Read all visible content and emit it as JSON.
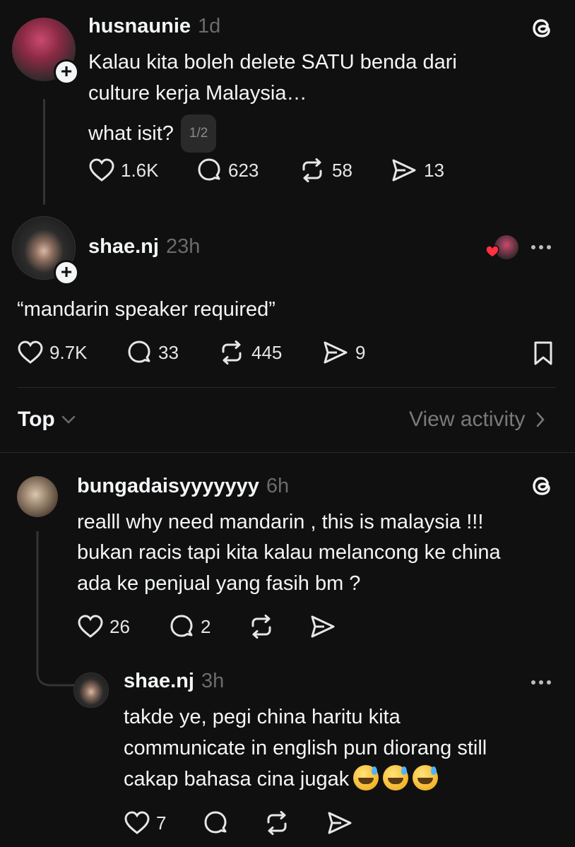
{
  "post1": {
    "username": "husnaunie",
    "time": "1d",
    "lines": [
      "Kalau kita boleh delete SATU benda dari",
      "culture kerja Malaysia…"
    ],
    "line3": "what isit?",
    "page_indicator": "1/2",
    "likes": "1.6K",
    "replies": "623",
    "reposts": "58",
    "shares": "13"
  },
  "post2": {
    "username": "shae.nj",
    "time": "23h",
    "text": "“mandarin speaker required”",
    "likes": "9.7K",
    "replies": "33",
    "reposts": "445",
    "shares": "9"
  },
  "filter": {
    "sort_label": "Top",
    "view_activity": "View activity"
  },
  "reply1": {
    "username": "bungadaisyyyyyyy",
    "time": "6h",
    "lines": [
      "realll why need mandarin , this is malaysia !!!",
      "bukan racis tapi kita kalau melancong ke china",
      "ada ke penjual yang fasih bm ?"
    ],
    "likes": "26",
    "replies": "2"
  },
  "reply2": {
    "username": "shae.nj",
    "time": "3h",
    "lines": [
      "takde ye, pegi china haritu kita",
      "communicate in english pun diorang still",
      "cakap bahasa cina jugak"
    ],
    "likes": "7"
  },
  "icons": {
    "threads": "threads-logo-icon",
    "like": "heart-icon",
    "reply": "comment-icon",
    "repost": "repost-icon",
    "share": "share-icon",
    "bookmark": "bookmark-icon",
    "more": "more-icon"
  },
  "colors": {
    "background": "#101010",
    "text": "#f3f5f7",
    "muted": "#6b6b6b",
    "heart_badge": "#ff3040"
  }
}
